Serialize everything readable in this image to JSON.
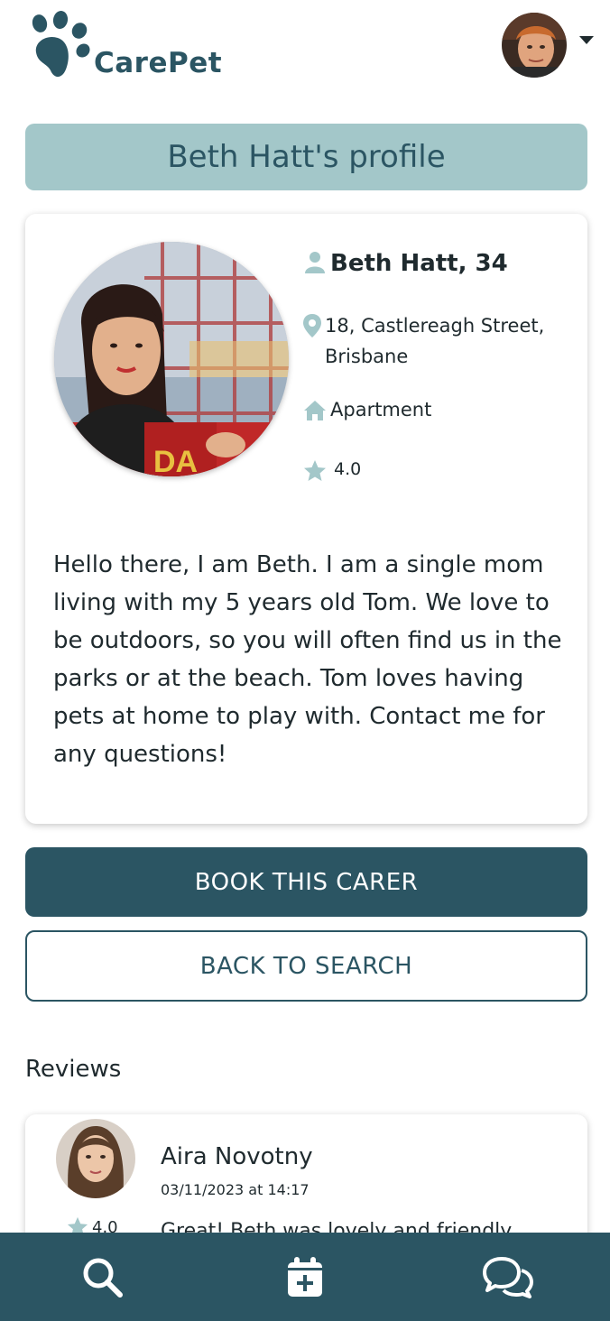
{
  "header": {
    "app_name": "CarePet",
    "brand_color": "#2b5563",
    "menu_icon": "chevron-down-icon"
  },
  "profile": {
    "title": "Beth Hatt's profile",
    "name_age": "Beth Hatt, 34",
    "address": "18, Castlereagh Street, Brisbane",
    "home_type": "Apartment",
    "rating": "4.0",
    "bio": "Hello there, I am Beth. I am a single mom living with my 5 years old Tom. We love to be outdoors, so you will often find us in the parks or at the beach. Tom loves having pets at home to play with. Contact me for any questions!"
  },
  "actions": {
    "book_label": "BOOK THIS CARER",
    "back_label": "BACK TO SEARCH"
  },
  "reviews": {
    "heading": "Reviews",
    "items": [
      {
        "name": "Aira Novotny",
        "date": "03/11/2023 at 14:17",
        "rating": "4.0",
        "text": "Great! Beth was lovely and friendly"
      }
    ]
  },
  "nav": {
    "items": [
      "search-icon",
      "calendar-plus-icon",
      "chat-icon"
    ]
  },
  "colors": {
    "accent": "#2b5563",
    "title_bar": "#a3c7c9",
    "icon_tint": "#a3c7c9"
  }
}
